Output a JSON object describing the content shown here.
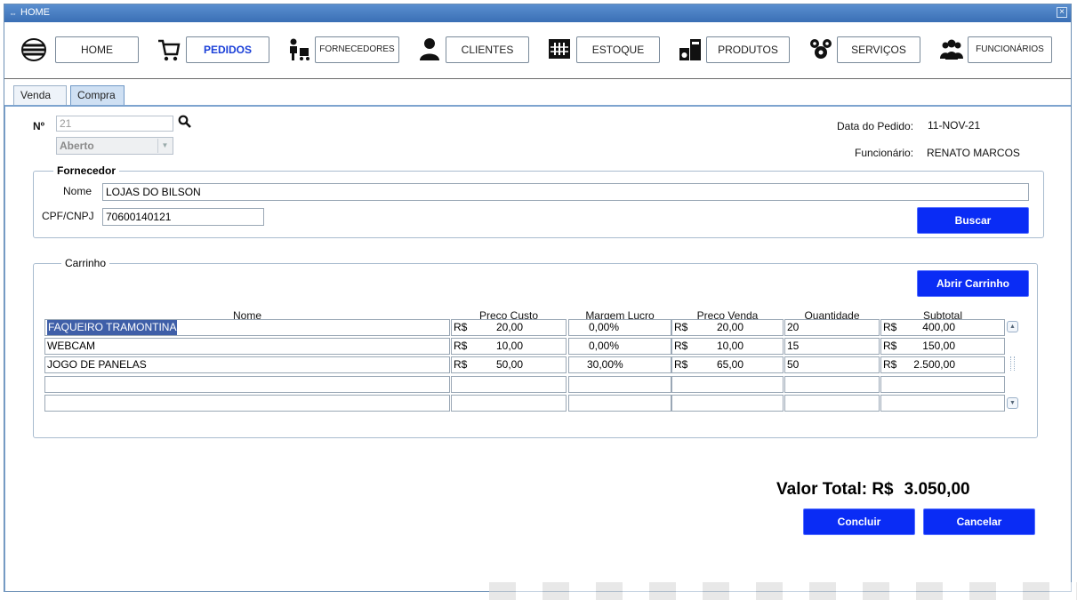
{
  "window": {
    "title": "HOME",
    "close_icon": "close-icon",
    "app_icon": "app-icon"
  },
  "nav": [
    {
      "icon": "globe-icon",
      "label": "HOME"
    },
    {
      "icon": "cart-icon",
      "label": "PEDIDOS",
      "active": true
    },
    {
      "icon": "supplier-icon",
      "label": "FORNECEDORES"
    },
    {
      "icon": "person-icon",
      "label": "CLIENTES"
    },
    {
      "icon": "warehouse-icon",
      "label": "ESTOQUE"
    },
    {
      "icon": "products-icon",
      "label": "PRODUTOS"
    },
    {
      "icon": "services-icon",
      "label": "SERVIÇOS"
    },
    {
      "icon": "team-icon",
      "label": "FUNCIONÁRIOS"
    }
  ],
  "tabs": [
    {
      "label": "Venda"
    },
    {
      "label": "Compra",
      "active": true
    }
  ],
  "order": {
    "number_label": "Nº",
    "number_value": "21",
    "status_value": "Aberto",
    "date_label": "Data do Pedido:",
    "date_value": "11-NOV-21",
    "employee_label": "Funcionário:",
    "employee_value": "RENATO MARCOS"
  },
  "supplier": {
    "legend": "Fornecedor",
    "name_label": "Nome",
    "name_value": "LOJAS DO BILSON",
    "doc_label": "CPF/CNPJ",
    "doc_value": "70600140121",
    "search_button": "Buscar"
  },
  "cart": {
    "legend": "Carrinho",
    "open_button": "Abrir Carrinho",
    "columns": [
      "Nome",
      "Preco Custo",
      "Margem Lucro",
      "Preco Venda",
      "Quantidade",
      "Subtotal"
    ],
    "currency": "R$",
    "rows": [
      {
        "name": "FAQUEIRO TRAMONTINA",
        "cost": "20,00",
        "margin": "0,00%",
        "price": "20,00",
        "qty": "20",
        "subtotal": "400,00"
      },
      {
        "name": "WEBCAM",
        "cost": "10,00",
        "margin": "0,00%",
        "price": "10,00",
        "qty": "15",
        "subtotal": "150,00"
      },
      {
        "name": "JOGO DE PANELAS",
        "cost": "50,00",
        "margin": "30,00%",
        "price": "65,00",
        "qty": "50",
        "subtotal": "2.500,00"
      }
    ]
  },
  "footer": {
    "total_label": "Valor Total: R$",
    "total_value": "3.050,00",
    "confirm_button": "Concluir",
    "cancel_button": "Cancelar"
  },
  "colors": {
    "accent": "#0a2cf5",
    "titlebar": "#3a6fb5",
    "tab_active": "#cfe0f3"
  }
}
